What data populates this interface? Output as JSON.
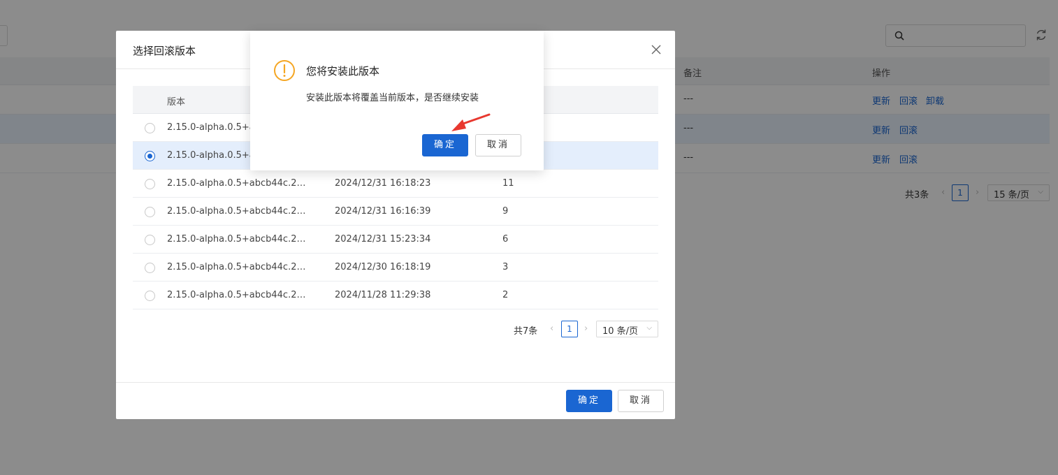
{
  "background": {
    "search": {
      "icon": "search-icon",
      "value": ""
    },
    "refresh_icon": "refresh-icon",
    "table": {
      "headers": {
        "remark": "备注",
        "actions": "操作"
      },
      "rows": [
        {
          "remark": "---",
          "actions": [
            "更新",
            "回滚",
            "卸载"
          ]
        },
        {
          "remark": "---",
          "actions": [
            "更新",
            "回滚"
          ]
        },
        {
          "remark": "---",
          "actions": [
            "更新",
            "回滚"
          ]
        }
      ]
    },
    "pagination": {
      "total": "共3条",
      "prev": "‹",
      "page": "1",
      "next": "›",
      "page_size": "15 条/页"
    }
  },
  "rollback_dialog": {
    "title": "选择回滚版本",
    "close_icon": "close-icon",
    "column_version": "版本",
    "rows": [
      {
        "version": "2.15.0-alpha.0.5+ab",
        "time": "",
        "num": "",
        "selected": false
      },
      {
        "version": "2.15.0-alpha.0.5+ab",
        "time": "",
        "num": "",
        "selected": true
      },
      {
        "version": "2.15.0-alpha.0.5+abcb44c.2024...",
        "time": "2024/12/31 16:18:23",
        "num": "11",
        "selected": false
      },
      {
        "version": "2.15.0-alpha.0.5+abcb44c.2024...",
        "time": "2024/12/31 16:16:39",
        "num": "9",
        "selected": false
      },
      {
        "version": "2.15.0-alpha.0.5+abcb44c.2024...",
        "time": "2024/12/31 15:23:34",
        "num": "6",
        "selected": false
      },
      {
        "version": "2.15.0-alpha.0.5+abcb44c.2024...",
        "time": "2024/12/30 16:18:19",
        "num": "3",
        "selected": false
      },
      {
        "version": "2.15.0-alpha.0.5+abcb44c.2024...",
        "time": "2024/11/28 11:29:38",
        "num": "2",
        "selected": false
      }
    ],
    "pagination": {
      "total": "共7条",
      "prev": "‹",
      "page": "1",
      "next": "›",
      "page_size": "10 条/页"
    },
    "confirm_label": "确定",
    "cancel_label": "取消"
  },
  "confirm_popup": {
    "icon": "warning-icon",
    "title": "您将安装此版本",
    "message": "安装此版本将覆盖当前版本，是否继续安装",
    "confirm_label": "确定",
    "cancel_label": "取消"
  },
  "colors": {
    "primary": "#1a66d2",
    "warning": "#f5a623",
    "arrow": "#e8382f"
  }
}
